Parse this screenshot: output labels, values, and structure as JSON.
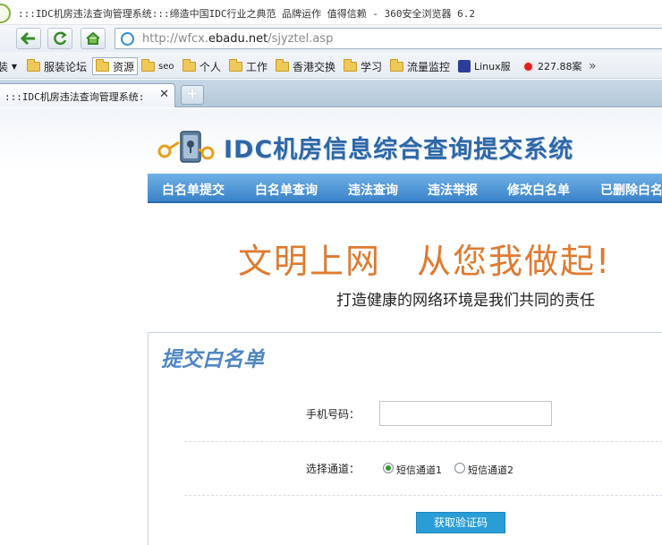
{
  "window": {
    "title": ":::IDC机房违法查询管理系统:::缔造中国IDC行业之典范 品牌运作 值得信赖 - 360安全浏览器 6.2"
  },
  "address_bar": {
    "url_prefix": "http://wfcx.",
    "url_domain": "ebadu.net",
    "url_path": "/sjyztel.asp"
  },
  "bookmarks": {
    "items": [
      {
        "label": "服装论坛",
        "icon": "folder-icon"
      },
      {
        "label": "资源",
        "icon": "folder-icon"
      },
      {
        "label": "seo",
        "icon": "folder-icon"
      },
      {
        "label": "个人",
        "icon": "folder-icon"
      },
      {
        "label": "工作",
        "icon": "folder-icon"
      },
      {
        "label": "香港交换",
        "icon": "folder-icon"
      },
      {
        "label": "学习",
        "icon": "folder-icon"
      },
      {
        "label": "流量监控",
        "icon": "folder-icon"
      },
      {
        "label": "Linux服",
        "icon": "paw-icon"
      },
      {
        "label": "227.88案",
        "icon": "red-ball-icon"
      }
    ],
    "more": "»",
    "partial_left": "装"
  },
  "tab": {
    "title": ":::IDC机房违法查询管理系统:",
    "close": "✕",
    "new_tab": "+"
  },
  "site": {
    "title": "IDC机房信息综合查询提交系统",
    "menu": [
      "白名单提交",
      "白名单查询",
      "违法查询",
      "违法举报",
      "修改白名单",
      "已删除白名"
    ],
    "slogan": "文明上网　从您我做起!",
    "subslogan": "打造健康的网络环境是我们共同的责任"
  },
  "form": {
    "title": "提交白名单",
    "phone_label": "手机号码：",
    "phone_value": "",
    "channel_label": "选择通道：",
    "channels": [
      {
        "label": "短信通道1",
        "checked": true
      },
      {
        "label": "短信通道2",
        "checked": false
      }
    ],
    "submit_label": "获取验证码"
  },
  "colors": {
    "menu_bar": "#3a82c9",
    "site_title": "#2d67a8",
    "slogan": "#e07a30",
    "form_title": "#4f86c4",
    "button": "#2a9dd6"
  }
}
